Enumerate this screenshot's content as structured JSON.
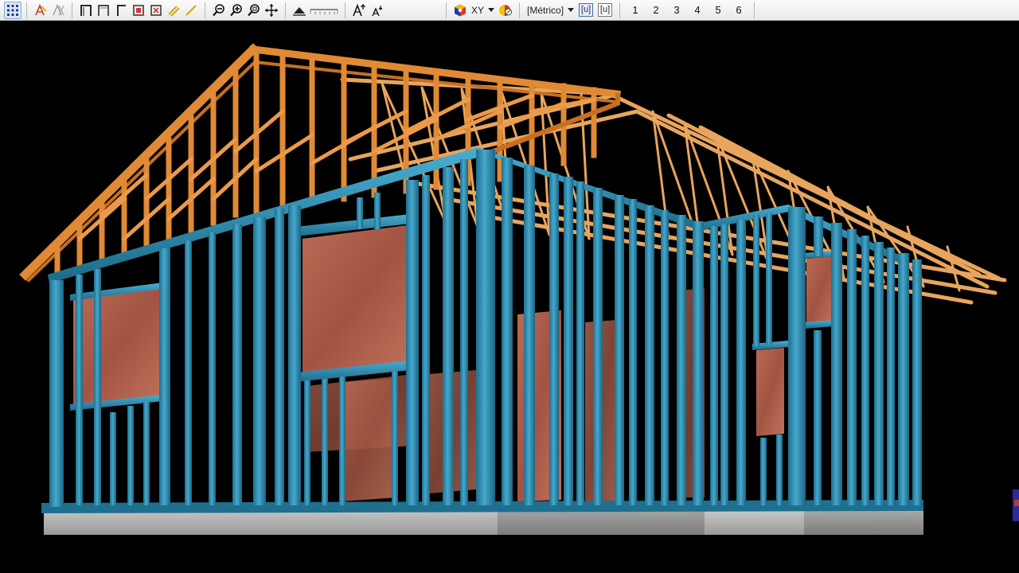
{
  "toolbar": {
    "plane_label": "XY",
    "units_label": "[Métrico]",
    "unit_box_1": "[u]",
    "unit_box_2": "[u]",
    "views": [
      "1",
      "2",
      "3",
      "4",
      "5",
      "6"
    ]
  },
  "colors": {
    "steel_frame": "#2f8db0",
    "wood_truss": "#e0913f",
    "sheathing": "#b0604d",
    "concrete_slab": "#a6a6a6",
    "background": "#000000"
  }
}
